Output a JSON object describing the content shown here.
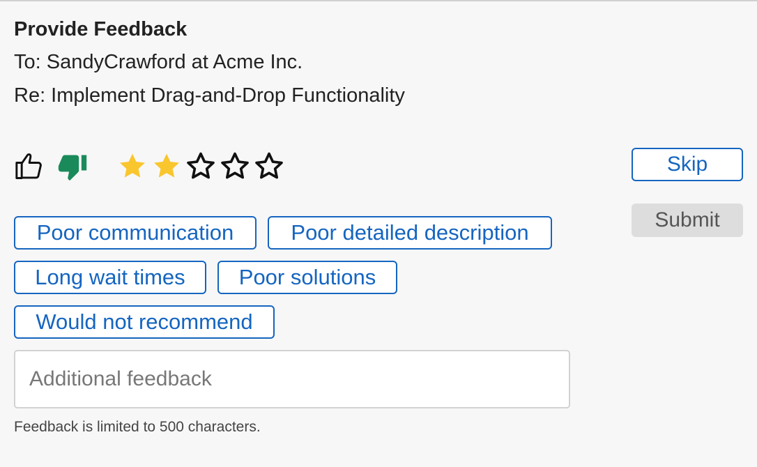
{
  "form": {
    "heading": "Provide Feedback",
    "to_line": "To: SandyCrawford at Acme Inc.",
    "re_line": "Re: Implement Drag-and-Drop Functionality"
  },
  "rating": {
    "thumbs": {
      "selected": "down",
      "up_icon": "thumb-up-outline-icon",
      "down_icon": "thumb-down-filled-icon",
      "down_color": "#1a8a5a"
    },
    "stars": {
      "value": 2,
      "max": 5,
      "filled_color": "#f9c62e",
      "empty_icon": "star-outline-icon",
      "filled_icon": "star-filled-icon"
    }
  },
  "actions": {
    "skip_label": "Skip",
    "submit_label": "Submit"
  },
  "tags": [
    "Poor communication",
    "Poor detailed description",
    "Long wait times",
    "Poor solutions",
    "Would not recommend"
  ],
  "feedback": {
    "value": "",
    "placeholder": "Additional feedback",
    "limit_note": "Feedback is limited to 500 characters."
  },
  "colors": {
    "accent": "#1565c0",
    "disabled_bg": "#dddddd",
    "page_bg": "#f7f7f7"
  }
}
